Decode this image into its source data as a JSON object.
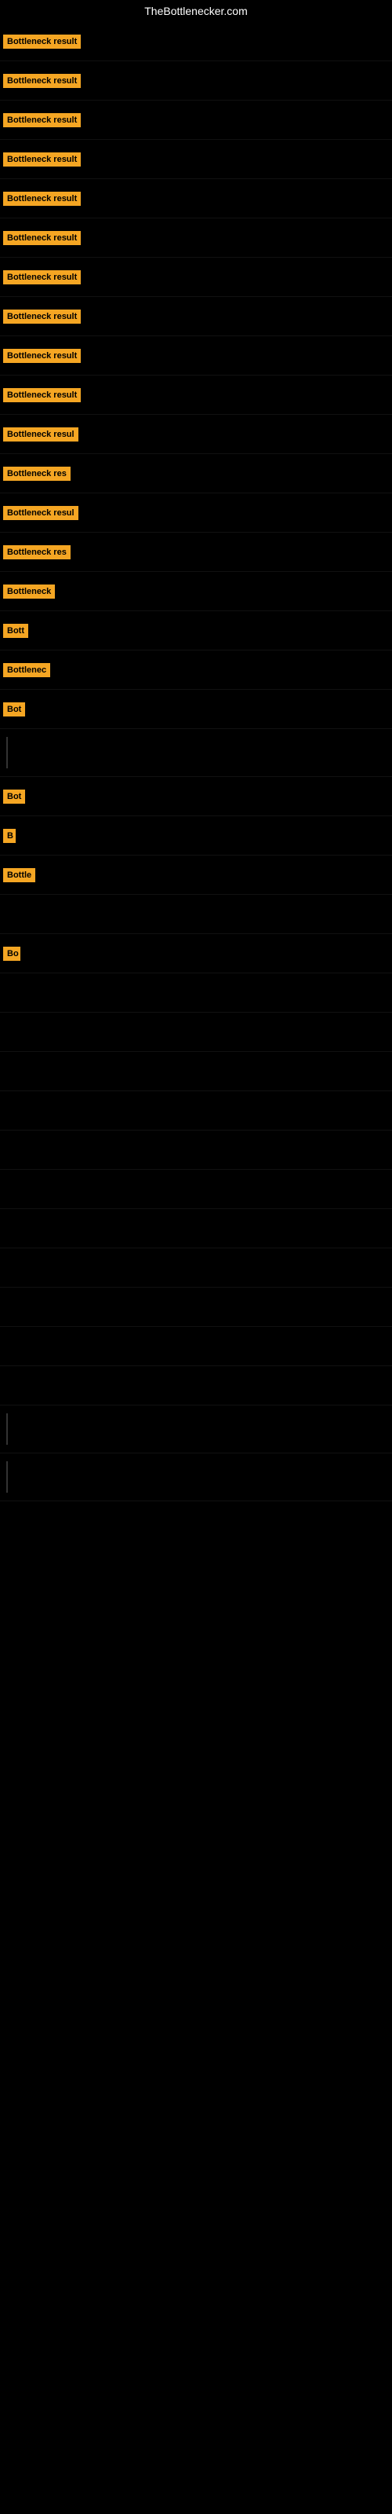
{
  "site": {
    "title": "TheBottlenecker.com"
  },
  "items": [
    {
      "label": "Bottleneck result",
      "badge_width": 120,
      "show_line": false
    },
    {
      "label": "Bottleneck result",
      "badge_width": 120,
      "show_line": false
    },
    {
      "label": "Bottleneck result",
      "badge_width": 120,
      "show_line": false
    },
    {
      "label": "Bottleneck result",
      "badge_width": 120,
      "show_line": false
    },
    {
      "label": "Bottleneck result",
      "badge_width": 120,
      "show_line": false
    },
    {
      "label": "Bottleneck result",
      "badge_width": 120,
      "show_line": false
    },
    {
      "label": "Bottleneck result",
      "badge_width": 120,
      "show_line": false
    },
    {
      "label": "Bottleneck result",
      "badge_width": 120,
      "show_line": false
    },
    {
      "label": "Bottleneck result",
      "badge_width": 120,
      "show_line": false
    },
    {
      "label": "Bottleneck result",
      "badge_width": 120,
      "show_line": false
    },
    {
      "label": "Bottleneck resul",
      "badge_width": 112,
      "show_line": false
    },
    {
      "label": "Bottleneck res",
      "badge_width": 100,
      "show_line": false
    },
    {
      "label": "Bottleneck resul",
      "badge_width": 112,
      "show_line": false
    },
    {
      "label": "Bottleneck res",
      "badge_width": 100,
      "show_line": false
    },
    {
      "label": "Bottleneck",
      "badge_width": 75,
      "show_line": false
    },
    {
      "label": "Bott",
      "badge_width": 38,
      "show_line": false
    },
    {
      "label": "Bottlenec",
      "badge_width": 68,
      "show_line": false
    },
    {
      "label": "Bot",
      "badge_width": 30,
      "show_line": false
    },
    {
      "label": "",
      "badge_width": 0,
      "show_line": true
    },
    {
      "label": "Bot",
      "badge_width": 30,
      "show_line": false
    },
    {
      "label": "B",
      "badge_width": 16,
      "show_line": false
    },
    {
      "label": "Bottle",
      "badge_width": 46,
      "show_line": false
    },
    {
      "label": "",
      "badge_width": 0,
      "show_line": false
    },
    {
      "label": "Bo",
      "badge_width": 22,
      "show_line": false
    },
    {
      "label": "",
      "badge_width": 0,
      "show_line": false
    },
    {
      "label": "",
      "badge_width": 0,
      "show_line": false
    },
    {
      "label": "",
      "badge_width": 0,
      "show_line": false
    },
    {
      "label": "",
      "badge_width": 0,
      "show_line": false
    },
    {
      "label": "",
      "badge_width": 0,
      "show_line": false
    },
    {
      "label": "",
      "badge_width": 0,
      "show_line": false
    },
    {
      "label": "",
      "badge_width": 0,
      "show_line": false
    },
    {
      "label": "",
      "badge_width": 0,
      "show_line": false
    },
    {
      "label": "",
      "badge_width": 0,
      "show_line": false
    },
    {
      "label": "",
      "badge_width": 0,
      "show_line": false
    },
    {
      "label": "",
      "badge_width": 0,
      "show_line": false
    },
    {
      "label": "",
      "badge_width": 0,
      "show_line": true
    },
    {
      "label": "",
      "badge_width": 0,
      "show_line": true
    }
  ]
}
